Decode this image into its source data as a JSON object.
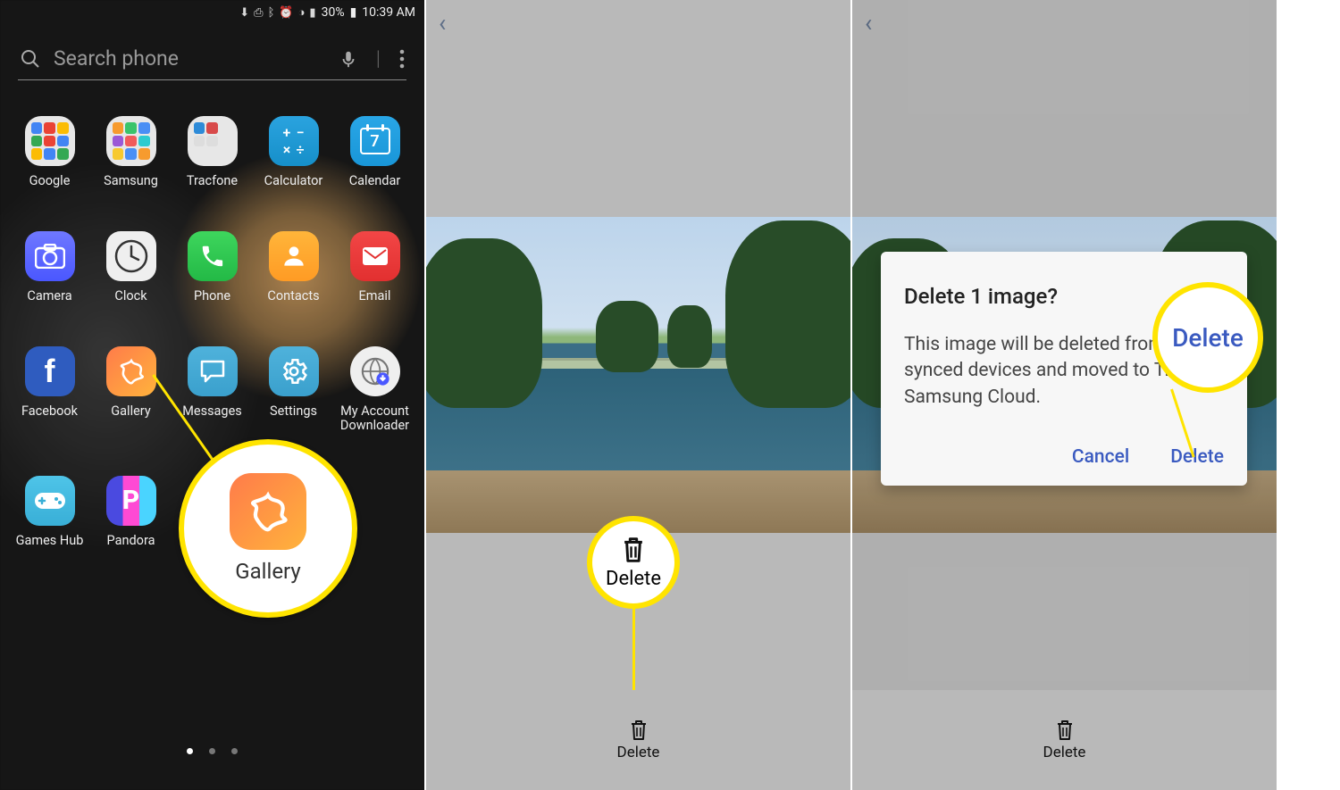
{
  "statusbar": {
    "battery": "30%",
    "time": "10:39 AM"
  },
  "search": {
    "placeholder": "Search phone"
  },
  "apps": {
    "row1": [
      {
        "label": "Google"
      },
      {
        "label": "Samsung"
      },
      {
        "label": "Tracfone"
      },
      {
        "label": "Calculator"
      },
      {
        "label": "Calendar",
        "badge": "7"
      }
    ],
    "row2": [
      {
        "label": "Camera"
      },
      {
        "label": "Clock"
      },
      {
        "label": "Phone"
      },
      {
        "label": "Contacts"
      },
      {
        "label": "Email"
      }
    ],
    "row3": [
      {
        "label": "Facebook"
      },
      {
        "label": "Gallery"
      },
      {
        "label": "Messages"
      },
      {
        "label": "Settings"
      },
      {
        "label": "My Account Downloader"
      }
    ],
    "row4": [
      {
        "label": "Games Hub"
      },
      {
        "label": "Pandora"
      }
    ]
  },
  "callouts": {
    "gallery_label": "Gallery",
    "delete_label": "Delete",
    "delete_dialog_button": "Delete"
  },
  "gallery": {
    "delete_button": "Delete"
  },
  "dialog": {
    "title": "Delete 1 image?",
    "body": "This image will be deleted from your synced devices and moved to Trash in Samsung Cloud.",
    "cancel": "Cancel",
    "confirm": "Delete"
  }
}
